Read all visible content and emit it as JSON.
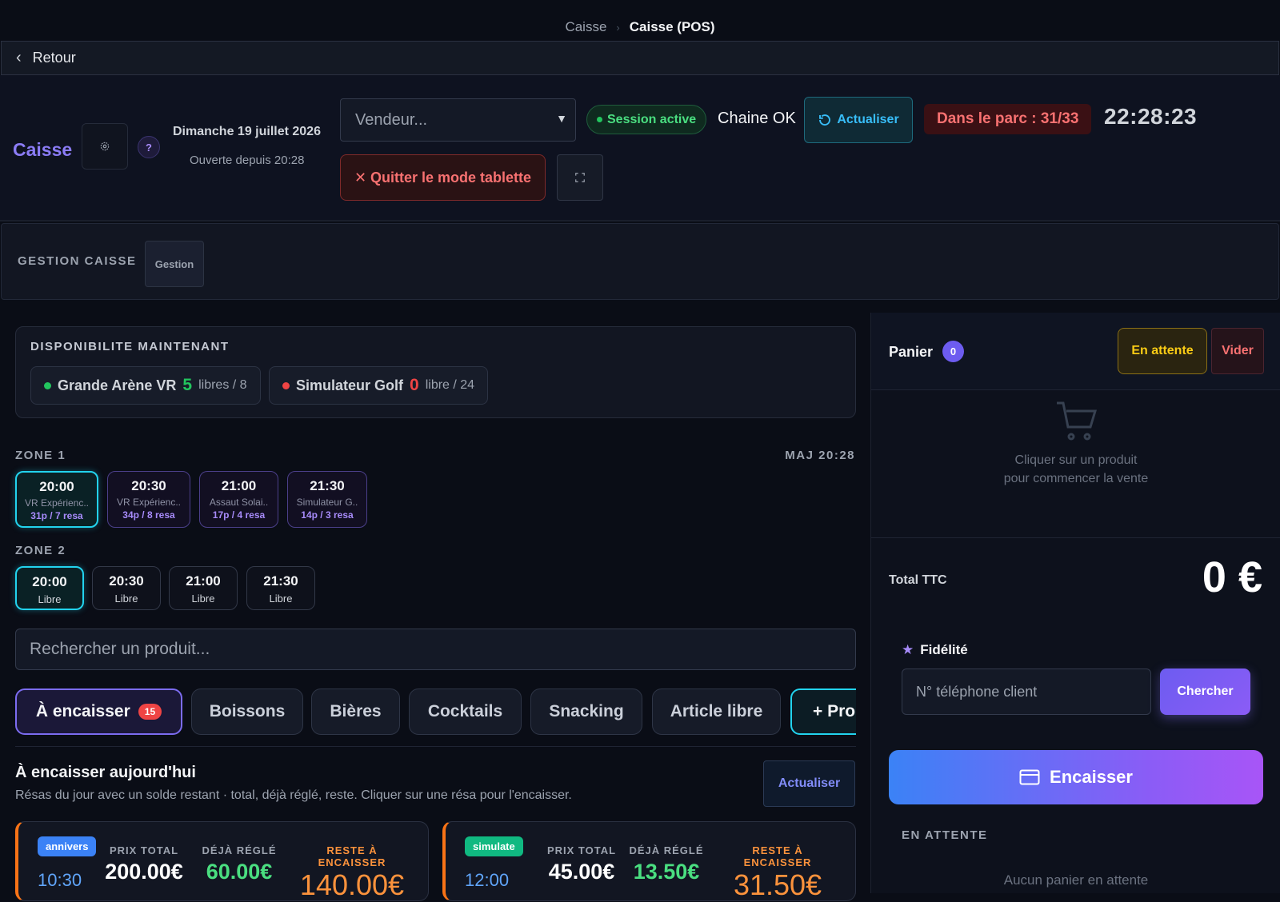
{
  "breadcrumb": {
    "parent": "Caisse",
    "separator": "›",
    "current": "Caisse (POS)"
  },
  "back": {
    "label": "Retour"
  },
  "header": {
    "title": "Caisse",
    "help": "?",
    "date": "Dimanche 19 juillet 2026",
    "open_since": "Ouverte depuis 20:28",
    "vendeur_placeholder": "Vendeur...",
    "session_status": "Session active",
    "chain_status": "Chaine OK",
    "refresh_label": "Actualiser",
    "park_count": "Dans le parc : 31/33",
    "clock": "22:28:23",
    "quit_tablet": "✕ Quitter le mode tablette"
  },
  "gestion": {
    "label": "GESTION CAISSE",
    "button": "Gestion"
  },
  "availability": {
    "title": "DISPONIBILITE MAINTENANT",
    "items": [
      {
        "name": "Grande Arène VR",
        "free": "5",
        "rest": "libres / 8",
        "status_color": "#22c55e"
      },
      {
        "name": "Simulateur Golf",
        "free": "0",
        "rest": "libre / 24",
        "status_color": "#ef4444"
      }
    ]
  },
  "zones": {
    "zone1_label": "ZONE 1",
    "updated": "MAJ 20:28",
    "zone1": [
      {
        "time": "20:00",
        "name": "VR Expérienc..",
        "resa": "31p / 7 resa"
      },
      {
        "time": "20:30",
        "name": "VR Expérienc..",
        "resa": "34p / 8 resa"
      },
      {
        "time": "21:00",
        "name": "Assaut Solai..",
        "resa": "17p / 4 resa"
      },
      {
        "time": "21:30",
        "name": "Simulateur G..",
        "resa": "14p / 3 resa"
      }
    ],
    "zone2_label": "ZONE 2",
    "zone2": [
      {
        "time": "20:00",
        "status": "Libre"
      },
      {
        "time": "20:30",
        "status": "Libre"
      },
      {
        "time": "21:00",
        "status": "Libre"
      },
      {
        "time": "21:30",
        "status": "Libre"
      }
    ]
  },
  "search": {
    "placeholder": "Rechercher un produit..."
  },
  "tabs": [
    {
      "label": "À encaisser",
      "badge": "15"
    },
    {
      "label": "Boissons"
    },
    {
      "label": "Bières"
    },
    {
      "label": "Cocktails"
    },
    {
      "label": "Snacking"
    },
    {
      "label": "Article libre"
    },
    {
      "label": "+ Prod"
    }
  ],
  "to_collect": {
    "title": "À encaisser aujourd'hui",
    "subtitle": "Résas du jour avec un solde restant · total, déjà réglé, reste. Cliquer sur une résa pour l'encaisser.",
    "refresh_label": "Actualiser",
    "col_total": "PRIX TOTAL",
    "col_paid": "DÉJÀ RÉGLÉ",
    "col_remaining": "RESTE À ENCAISSER",
    "cards": [
      {
        "tag": "annivers",
        "tag_color": "#3b82f6",
        "time": "10:30",
        "total": "200.00€",
        "paid": "60.00€",
        "remaining": "140.00€"
      },
      {
        "tag": "simulate",
        "tag_color": "#10b981",
        "time": "12:00",
        "total": "45.00€",
        "paid": "13.50€",
        "remaining": "31.50€"
      }
    ]
  },
  "cart": {
    "label": "Panier",
    "count": "0",
    "hold_label": "En attente",
    "clear_label": "Vider",
    "empty_line1": "Cliquer sur un produit",
    "empty_line2": "pour commencer la vente",
    "total_label": "Total TTC",
    "total_value": "0 €",
    "loyalty_title": "Fidélité",
    "phone_placeholder": "N° téléphone client",
    "search_label": "Chercher",
    "checkout_label": "Encaisser",
    "pending_label": "EN ATTENTE",
    "pending_empty": "Aucun panier en attente"
  },
  "colors": {
    "accent": "#8b7cf6",
    "cyan": "#22d3ee",
    "danger": "#f87171",
    "warning": "#facc15",
    "success": "#4ade80",
    "orange": "#fb923c"
  }
}
